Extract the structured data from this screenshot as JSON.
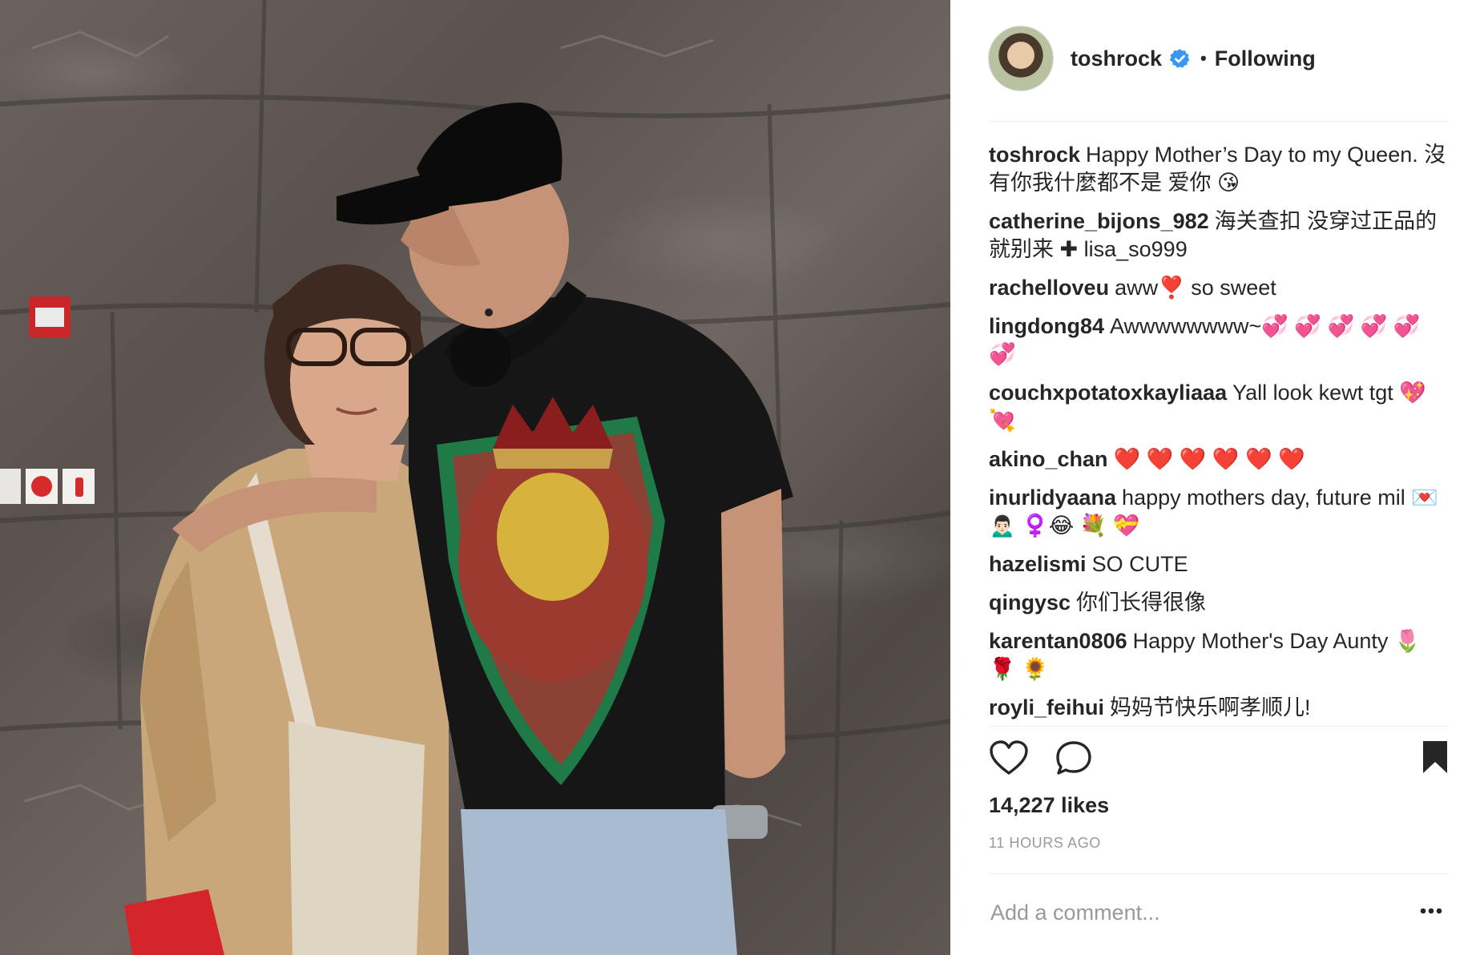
{
  "post": {
    "author": {
      "username": "toshrock",
      "verified": true,
      "follow_status": "Following",
      "separator": "•"
    },
    "colors": {
      "text": "#262626",
      "muted": "#999999",
      "verified_blue": "#3897f0",
      "divider": "#efefef"
    },
    "comments": [
      {
        "author": "toshrock",
        "text": "Happy Mother’s Day to my Queen. 沒有你我什麼都不是 爱你 😘"
      },
      {
        "author": "catherine_bijons_982",
        "text": "海关查扣 没穿过正品的就别来 ✚ lisa_so999"
      },
      {
        "author": "rachelloveu",
        "text": "aww❣️ so sweet"
      },
      {
        "author": "lingdong84",
        "text": "Awwwwwwww~💞 💞 💞 💞 💞 💞"
      },
      {
        "author": "couchxpotatoxkayliaaa",
        "text": "Yall look kewt tgt 💖 💘"
      },
      {
        "author": "akino_chan",
        "text": "❤️ ❤️ ❤️ ❤️ ❤️ ❤️"
      },
      {
        "author": "inurlidyaana",
        "text": "happy mothers day, future mil 💌 🙍🏻‍♂️ ♀️😂 💐 💝"
      },
      {
        "author": "hazelismi",
        "text": "SO CUTE"
      },
      {
        "author": "qingysc",
        "text": "你们长得很像"
      },
      {
        "author": "karentan0806",
        "text": "Happy Mother's Day Aunty 🌷 🌹 🌻"
      },
      {
        "author": "royli_feihui",
        "text": "妈妈节快乐啊孝顺儿!"
      }
    ],
    "actions": {
      "like_icon": "heart-outline-icon",
      "comment_icon": "speech-bubble-icon",
      "save_icon": "bookmark-filled-icon"
    },
    "likes": "14,227 likes",
    "timestamp": "11 HOURS AGO",
    "add_comment": {
      "placeholder": "Add a comment...",
      "value": ""
    },
    "more_icon": "ellipsis-icon"
  }
}
